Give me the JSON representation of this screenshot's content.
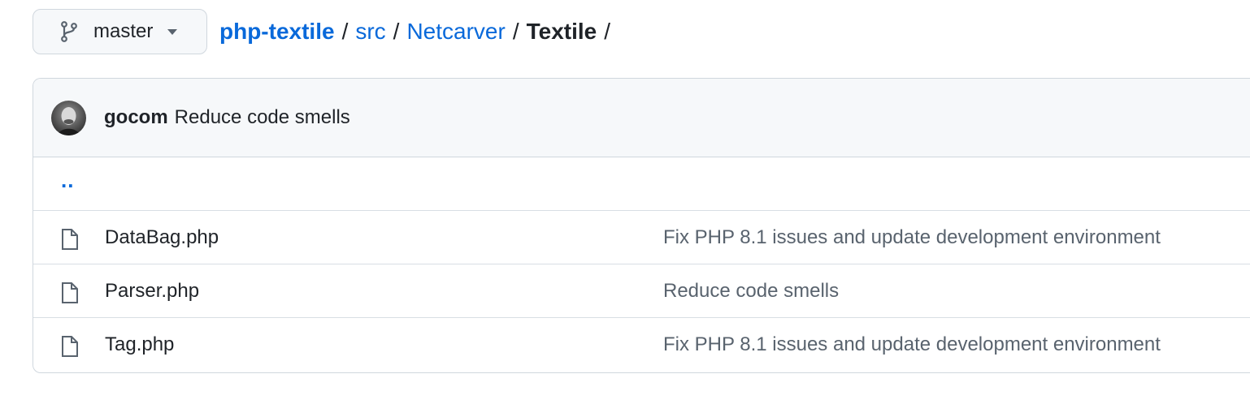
{
  "branch": {
    "name": "master",
    "icon": "git-branch-icon"
  },
  "breadcrumb": {
    "repo": "php-textile",
    "parts": [
      "src",
      "Netcarver"
    ],
    "current": "Textile",
    "separator": "/"
  },
  "latest_commit": {
    "author": "gocom",
    "message": "Reduce code smells"
  },
  "parent_dir_label": "..",
  "files": [
    {
      "name": "DataBag.php",
      "commit_message": "Fix PHP 8.1 issues and update development environment",
      "icon": "file-icon"
    },
    {
      "name": "Parser.php",
      "commit_message": "Reduce code smells",
      "icon": "file-icon"
    },
    {
      "name": "Tag.php",
      "commit_message": "Fix PHP 8.1 issues and update development environment",
      "icon": "file-icon"
    }
  ],
  "colors": {
    "link": "#0969da",
    "muted": "#59636e",
    "border": "#d0d7de",
    "header_bg": "#f6f8fa"
  }
}
